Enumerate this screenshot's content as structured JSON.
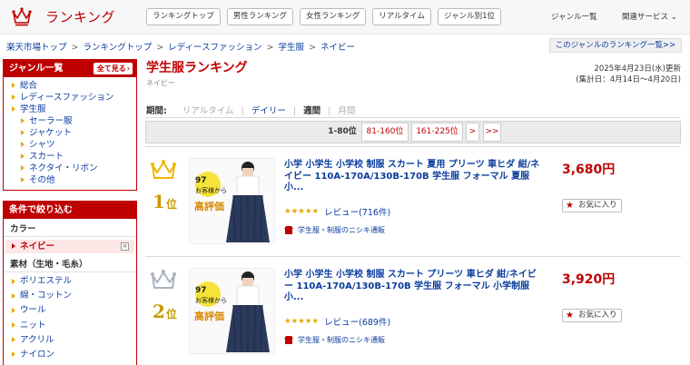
{
  "header": {
    "brand_title": "ランキング",
    "tabs": [
      "ランキングトップ",
      "男性ランキング",
      "女性ランキング",
      "リアルタイム",
      "ジャンル別1位"
    ],
    "genre_list": "ジャンル一覧",
    "related_services": "関連サービス"
  },
  "breadcrumb": [
    "楽天市場トップ",
    "ランキングトップ",
    "レディースファッション",
    "学生服",
    "ネイビー"
  ],
  "genre_ranking_link": "このジャンルのランキング一覧>>",
  "sidebar": {
    "genre_title": "ジャンル一覧",
    "see_all": "全て見る",
    "genres": [
      {
        "label": "総合",
        "level": 1
      },
      {
        "label": "レディースファッション",
        "level": 1
      },
      {
        "label": "学生服",
        "level": 1
      },
      {
        "label": "セーラー服",
        "level": 2
      },
      {
        "label": "ジャケット",
        "level": 2
      },
      {
        "label": "シャツ",
        "level": 2
      },
      {
        "label": "スカート",
        "level": 2
      },
      {
        "label": "ネクタイ・リボン",
        "level": 2
      },
      {
        "label": "その他",
        "level": 2
      }
    ],
    "filter_title": "条件で絞り込む",
    "color_title": "カラー",
    "color_selected": "ネイビー",
    "material_title": "素材（生地・毛糸）",
    "materials": [
      "ポリエステル",
      "綿・コットン",
      "ウール",
      "ニット",
      "アクリル",
      "ナイロン"
    ]
  },
  "main": {
    "title": "学生服ランキング",
    "subtitle": "ネイビー",
    "updated_line1": "2025年4月23日(水)更新",
    "updated_line2": "(集計日：4月14日〜4月20日)",
    "period_label": "期間:",
    "periods": {
      "realtime": "リアルタイム",
      "daily": "デイリー",
      "weekly": "週間",
      "monthly": "月間"
    },
    "pager": {
      "current": "1-80位",
      "p2": "81-160位",
      "p3": "161-225位",
      "next": ">",
      "last": ">>"
    }
  },
  "items": [
    {
      "rank": "1",
      "rank_suffix": "位",
      "title": "小学 小学生 小学校 制服 スカート 夏用 プリーツ 車ヒダ 紺/ネイビー 110A-170A/130B-170B 学生服 フォーマル 夏服 小...",
      "review": "レビュー(716件)",
      "rating": 4.5,
      "shop": "学生服・制服のニシキ通販",
      "price": "3,680円",
      "fav": "お気に入り",
      "badge_line1": "97",
      "badge_line2": "お客様から",
      "badge_big": "高評価",
      "crown_color": "#f0b400"
    },
    {
      "rank": "2",
      "rank_suffix": "位",
      "title": "小学 小学生 小学校 制服 スカート プリーツ 車ヒダ 紺/ネイビー 110A-170A/130B-170B 学生服 フォーマル 小学制服 小...",
      "review": "レビュー(689件)",
      "rating": 4.5,
      "shop": "学生服・制服のニシキ通販",
      "price": "3,920円",
      "fav": "お気に入り",
      "badge_line1": "97",
      "badge_line2": "お客様から",
      "badge_big": "高評価",
      "crown_color": "#a9b3c2"
    }
  ]
}
